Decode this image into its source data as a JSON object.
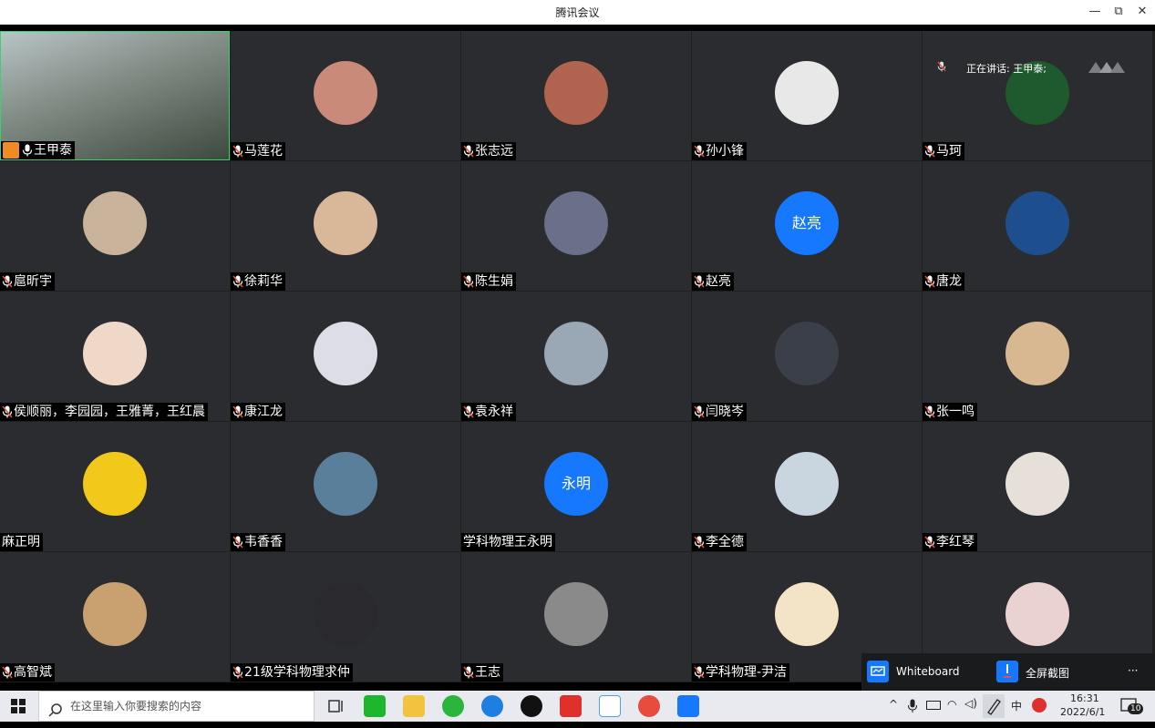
{
  "window": {
    "title": "腾讯会议",
    "minimize": "—",
    "restore": "⧉",
    "close": "✕"
  },
  "speaking": {
    "label": "正在讲话: 王甲泰;"
  },
  "participants": [
    {
      "name": "王甲泰",
      "avatar_text": "",
      "avatar_color": "#6b7a6a",
      "muted": false
    },
    {
      "name": "马莲花",
      "avatar_text": "",
      "avatar_color": "#c98a7a",
      "muted": true
    },
    {
      "name": "张志远",
      "avatar_text": "",
      "avatar_color": "#b0634f",
      "muted": true
    },
    {
      "name": "孙小锋",
      "avatar_text": "",
      "avatar_color": "#e8e8e8",
      "muted": true
    },
    {
      "name": "马珂",
      "avatar_text": "",
      "avatar_color": "#1e5a2e",
      "muted": true
    },
    {
      "name": "扈昕宇",
      "avatar_text": "",
      "avatar_color": "#c9b39a",
      "muted": true
    },
    {
      "name": "徐莉华",
      "avatar_text": "",
      "avatar_color": "#d9b89a",
      "muted": true
    },
    {
      "name": "陈生娟",
      "avatar_text": "",
      "avatar_color": "#6a6f8a",
      "muted": true
    },
    {
      "name": "赵亮",
      "avatar_text": "赵亮",
      "avatar_color": "#1677ff",
      "muted": true
    },
    {
      "name": "唐龙",
      "avatar_text": "",
      "avatar_color": "#1d4f8f",
      "muted": true
    },
    {
      "name": "侯顺丽，李园园，王雅菁，王红晨",
      "avatar_text": "",
      "avatar_color": "#f0d8c8",
      "muted": true
    },
    {
      "name": "康江龙",
      "avatar_text": "",
      "avatar_color": "#dcdde6",
      "muted": true
    },
    {
      "name": "袁永祥",
      "avatar_text": "",
      "avatar_color": "#9aa7b5",
      "muted": true
    },
    {
      "name": "闫晓岑",
      "avatar_text": "",
      "avatar_color": "#3a3f4a",
      "muted": true
    },
    {
      "name": "张一鸣",
      "avatar_text": "",
      "avatar_color": "#d8b890",
      "muted": true
    },
    {
      "name": "麻正明",
      "avatar_text": "",
      "avatar_color": "#f2c81a",
      "muted": false
    },
    {
      "name": "韦香香",
      "avatar_text": "",
      "avatar_color": "#5a7f9a",
      "muted": true
    },
    {
      "name": "学科物理王永明",
      "avatar_text": "永明",
      "avatar_color": "#1677ff",
      "muted": false
    },
    {
      "name": "李全德",
      "avatar_text": "",
      "avatar_color": "#c9d6e0",
      "muted": true
    },
    {
      "name": "李红琴",
      "avatar_text": "",
      "avatar_color": "#e6e0d8",
      "muted": true
    },
    {
      "name": "高智斌",
      "avatar_text": "",
      "avatar_color": "#c9a070",
      "muted": true
    },
    {
      "name": "21级学科物理求仲",
      "avatar_text": "",
      "avatar_color": "#2a2a2e",
      "muted": true
    },
    {
      "name": "王志",
      "avatar_text": "",
      "avatar_color": "#8a8a8a",
      "muted": true
    },
    {
      "name": "学科物理-尹洁",
      "avatar_text": "",
      "avatar_color": "#f3e4c8",
      "muted": true
    },
    {
      "name": "",
      "avatar_text": "",
      "avatar_color": "#e9d2cf",
      "muted": false
    }
  ],
  "popup": {
    "whiteboard": "Whiteboard",
    "screenshot": "全屏截图",
    "more": "···"
  },
  "taskbar": {
    "search_placeholder": "在这里输入你要搜索的内容",
    "ime": "中",
    "time": "16:31",
    "date": "2022/6/1",
    "notif_count": "10"
  }
}
